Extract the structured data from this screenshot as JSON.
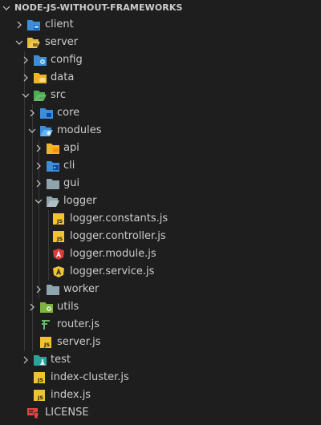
{
  "explorer": {
    "title": "NODE-JS-WITHOUT-FRAMEWORKS",
    "items": [
      {
        "label": "client"
      },
      {
        "label": "server"
      },
      {
        "label": "config"
      },
      {
        "label": "data"
      },
      {
        "label": "src"
      },
      {
        "label": "core"
      },
      {
        "label": "modules"
      },
      {
        "label": "api"
      },
      {
        "label": "cli"
      },
      {
        "label": "gui"
      },
      {
        "label": "logger"
      },
      {
        "label": "logger.constants.js"
      },
      {
        "label": "logger.controller.js"
      },
      {
        "label": "logger.module.js"
      },
      {
        "label": "logger.service.js"
      },
      {
        "label": "worker"
      },
      {
        "label": "utils"
      },
      {
        "label": "router.js"
      },
      {
        "label": "server.js"
      },
      {
        "label": "test"
      },
      {
        "label": "index-cluster.js"
      },
      {
        "label": "index.js"
      },
      {
        "label": "LICENSE"
      }
    ]
  },
  "colors": {
    "background": "#1e1e1e",
    "text": "#cccccc",
    "js_badge": "#f1c232",
    "angular_red": "#dd3b3b",
    "client_folder": "#3c8ed8",
    "server_folder": "#e8b93c",
    "src_folder": "#4caf50",
    "license_icon": "#e84343"
  }
}
